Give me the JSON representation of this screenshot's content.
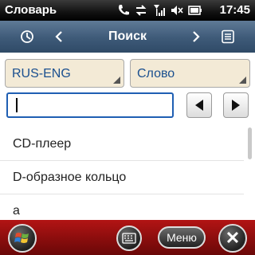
{
  "status_bar": {
    "app_title": "Словарь",
    "time": "17:45",
    "icons": [
      "phone-icon",
      "sync-icon",
      "signal-icon",
      "volume-icon",
      "battery-icon"
    ]
  },
  "toolbar": {
    "title": "Поиск",
    "history_icon": "history-icon",
    "prev_icon": "chevron-left-icon",
    "next_icon": "chevron-right-icon",
    "list_icon": "list-icon"
  },
  "filters": {
    "language": "RUS-ENG",
    "mode": "Слово"
  },
  "search": {
    "value": ""
  },
  "results": [
    "CD-плеер",
    "D-образное кольцо",
    "a"
  ],
  "softkeys": {
    "menu_label": "Меню",
    "close_symbol": "✕"
  },
  "colors": {
    "header": "#3e5a78",
    "bottom_bar": "#8a0d0d",
    "dropdown_bg": "#f3ead6",
    "dropdown_text": "#1a4f8f",
    "input_border": "#1f5fb3"
  }
}
